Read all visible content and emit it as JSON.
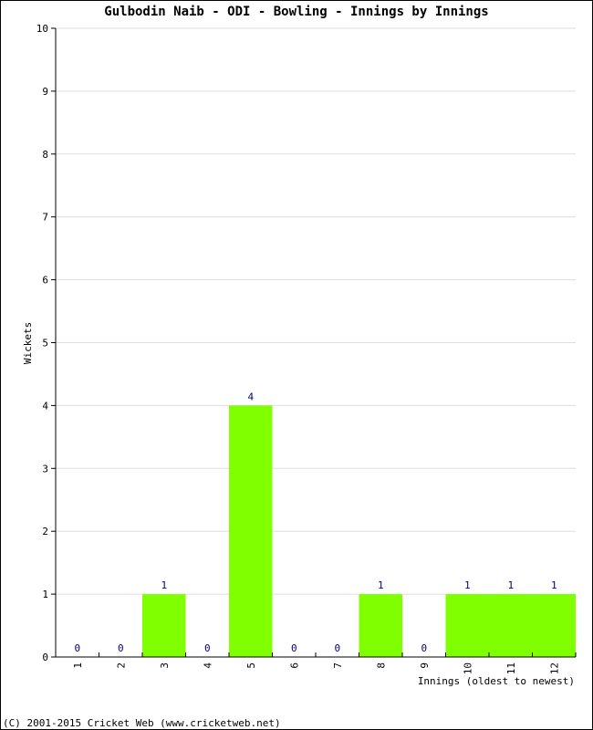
{
  "chart_data": {
    "type": "bar",
    "title": "Gulbodin Naib - ODI - Bowling - Innings by Innings",
    "xlabel": "Innings (oldest to newest)",
    "ylabel": "Wickets",
    "categories": [
      "1",
      "2",
      "3",
      "4",
      "5",
      "6",
      "7",
      "8",
      "9",
      "10",
      "11",
      "12"
    ],
    "values": [
      0,
      0,
      1,
      0,
      4,
      0,
      0,
      1,
      0,
      1,
      1,
      1
    ],
    "data_labels": [
      "0",
      "0",
      "1",
      "0",
      "4",
      "0",
      "0",
      "1",
      "0",
      "1",
      "1",
      "1"
    ],
    "ylim": [
      0,
      10
    ],
    "yticks": [
      0,
      1,
      2,
      3,
      4,
      5,
      6,
      7,
      8,
      9,
      10
    ],
    "grid": true,
    "legend": "none",
    "bar_color": "#80ff00",
    "label_color": "#000080",
    "grid_color": "#dddddd"
  },
  "footer": {
    "copyright": "(C) 2001-2015 Cricket Web (www.cricketweb.net)"
  }
}
